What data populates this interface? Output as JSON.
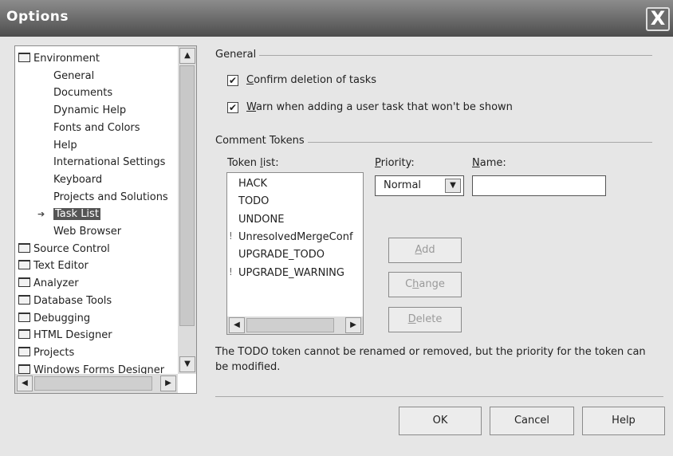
{
  "window": {
    "title": "Options",
    "close_glyph": "X"
  },
  "tree": {
    "items": [
      {
        "label": "Environment",
        "kind": "folder-open"
      },
      {
        "label": "General",
        "kind": "child"
      },
      {
        "label": "Documents",
        "kind": "child"
      },
      {
        "label": "Dynamic Help",
        "kind": "child"
      },
      {
        "label": "Fonts and Colors",
        "kind": "child"
      },
      {
        "label": "Help",
        "kind": "child"
      },
      {
        "label": "International Settings",
        "kind": "child"
      },
      {
        "label": "Keyboard",
        "kind": "child"
      },
      {
        "label": "Projects and Solutions",
        "kind": "child"
      },
      {
        "label": "Task List",
        "kind": "child",
        "selected": true
      },
      {
        "label": "Web Browser",
        "kind": "child"
      },
      {
        "label": "Source Control",
        "kind": "folder"
      },
      {
        "label": "Text Editor",
        "kind": "folder"
      },
      {
        "label": "Analyzer",
        "kind": "folder"
      },
      {
        "label": "Database Tools",
        "kind": "folder"
      },
      {
        "label": "Debugging",
        "kind": "folder"
      },
      {
        "label": "HTML Designer",
        "kind": "folder"
      },
      {
        "label": "Projects",
        "kind": "folder"
      },
      {
        "label": "Windows Forms Designer",
        "kind": "folder"
      }
    ]
  },
  "general": {
    "heading": "General",
    "confirm_deletion": {
      "checked": true,
      "key": "C",
      "rest": "onfirm deletion of tasks"
    },
    "warn_adding": {
      "checked": true,
      "key": "W",
      "rest": "arn when adding a user task that won't be shown"
    }
  },
  "comment_tokens": {
    "heading": "Comment Tokens",
    "token_list_label": {
      "pre": "Token ",
      "key": "l",
      "post": "ist:"
    },
    "priority_label": {
      "key": "P",
      "rest": "riority:"
    },
    "name_label": {
      "key": "N",
      "rest": "ame:"
    },
    "priority_value": "Normal",
    "name_value": "",
    "tokens": [
      {
        "label": "HACK",
        "warning": false
      },
      {
        "label": "TODO",
        "warning": false
      },
      {
        "label": "UNDONE",
        "warning": false
      },
      {
        "label": "UnresolvedMergeConf",
        "warning": true
      },
      {
        "label": "UPGRADE_TODO",
        "warning": false
      },
      {
        "label": "UPGRADE_WARNING",
        "warning": true
      }
    ],
    "buttons": {
      "add": {
        "key": "A",
        "rest": "dd"
      },
      "change": {
        "pre": "C",
        "key": "h",
        "post": "ange"
      },
      "delete": {
        "key": "D",
        "rest": "elete"
      }
    },
    "note": "The TODO token cannot be renamed or removed, but the priority for the token can be modified."
  },
  "footer": {
    "ok": "OK",
    "cancel": "Cancel",
    "help": "Help"
  },
  "colors": {
    "titlebar": "#5a5a5a",
    "selection": "#555555",
    "dialog_bg": "#e6e6e6"
  }
}
